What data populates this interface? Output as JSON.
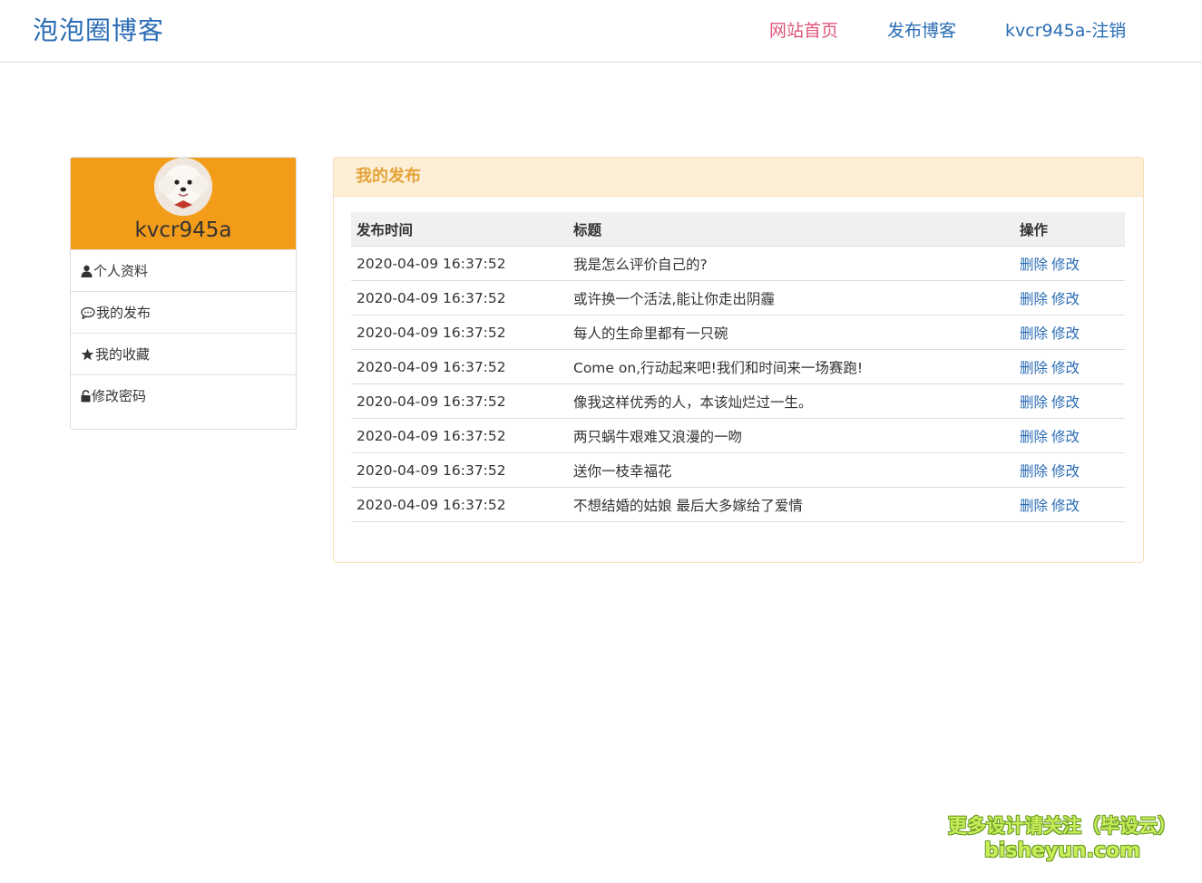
{
  "header": {
    "brand": "泡泡圈博客",
    "nav": {
      "home": "网站首页",
      "publish": "发布博客",
      "user": "kvcr945a-注销"
    },
    "colors": {
      "brand": "#2a6cb5",
      "active_nav": "#e0557a"
    }
  },
  "sidebar": {
    "username": "kvcr945a",
    "items": [
      {
        "label": "个人资料",
        "icon": "user-icon"
      },
      {
        "label": "我的发布",
        "icon": "comment-icon"
      },
      {
        "label": "我的收藏",
        "icon": "star-icon"
      },
      {
        "label": "修改密码",
        "icon": "lock-icon"
      }
    ],
    "colors": {
      "header_bg": "#f39c1a"
    }
  },
  "main": {
    "panel_title": "我的发布",
    "table": {
      "headers": [
        "发布时间",
        "标题",
        "操作"
      ],
      "rows": [
        {
          "time": "2020-04-09 16:37:52",
          "title": "我是怎么评价自己的?",
          "delete": "删除",
          "edit": "修改"
        },
        {
          "time": "2020-04-09 16:37:52",
          "title": "或许换一个活法,能让你走出阴霾",
          "delete": "删除",
          "edit": "修改"
        },
        {
          "time": "2020-04-09 16:37:52",
          "title": "每人的生命里都有一只碗",
          "delete": "删除",
          "edit": "修改"
        },
        {
          "time": "2020-04-09 16:37:52",
          "title": "Come on,行动起来吧!我们和时间来一场赛跑!",
          "delete": "删除",
          "edit": "修改"
        },
        {
          "time": "2020-04-09 16:37:52",
          "title": "像我这样优秀的人，本该灿烂过一生。",
          "delete": "删除",
          "edit": "修改"
        },
        {
          "time": "2020-04-09 16:37:52",
          "title": "两只蜗牛艰难又浪漫的一吻",
          "delete": "删除",
          "edit": "修改"
        },
        {
          "time": "2020-04-09 16:37:52",
          "title": "送你一枝幸福花",
          "delete": "删除",
          "edit": "修改"
        },
        {
          "time": "2020-04-09 16:37:52",
          "title": "不想结婚的姑娘 最后大多嫁给了爱情",
          "delete": "删除",
          "edit": "修改"
        }
      ]
    },
    "colors": {
      "panel_head_bg": "#fcefd6",
      "panel_title": "#e5a33a",
      "link": "#2a6cb5"
    }
  },
  "watermark": {
    "line1": "更多设计请关注（毕设云）",
    "line2": "bisheyun.com"
  }
}
